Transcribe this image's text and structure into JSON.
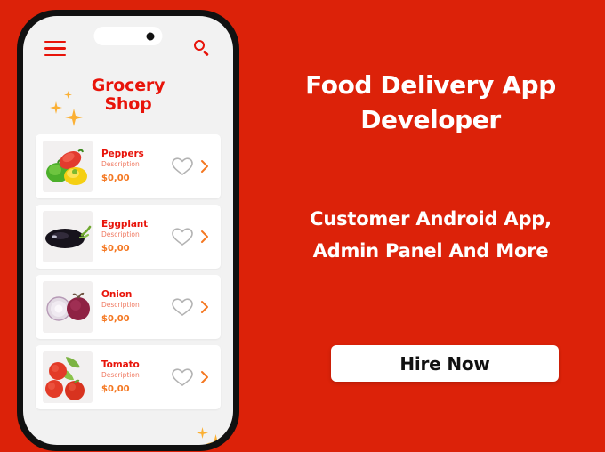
{
  "background_color": "#dc2209",
  "accent_colors": {
    "red": "#e8140a",
    "orange": "#f47721",
    "desc_salmon": "#f07a62",
    "sparkle_gold": "#fbb034",
    "white": "#ffffff",
    "black": "#111111"
  },
  "phone": {
    "screen_bg": "#f2f2f2",
    "frame_color": "#111111",
    "topbar": {
      "menu_icon": "hamburger-menu-icon",
      "search_icon": "search-icon",
      "notch": "dynamic-island"
    },
    "shop_title_line1": "Grocery",
    "shop_title_line2": "Shop",
    "products": [
      {
        "name": "Peppers",
        "description": "Description",
        "price": "$0,00",
        "image": "bell-peppers-photo",
        "favorite_icon": "heart-outline-icon",
        "chevron_icon": "chevron-right-icon"
      },
      {
        "name": "Eggplant",
        "description": "Description",
        "price": "$0,00",
        "image": "eggplant-photo",
        "favorite_icon": "heart-outline-icon",
        "chevron_icon": "chevron-right-icon"
      },
      {
        "name": "Onion",
        "description": "Description",
        "price": "$0,00",
        "image": "onion-photo",
        "favorite_icon": "heart-outline-icon",
        "chevron_icon": "chevron-right-icon"
      },
      {
        "name": "Tomato",
        "description": "Description",
        "price": "$0,00",
        "image": "tomatoes-photo",
        "favorite_icon": "heart-outline-icon",
        "chevron_icon": "chevron-right-icon"
      }
    ]
  },
  "promo": {
    "headline_line1": "Food Delivery App",
    "headline_line2": "Developer",
    "subline_line1": "Customer Android App,",
    "subline_line2": "Admin Panel And More",
    "cta_label": "Hire Now"
  }
}
